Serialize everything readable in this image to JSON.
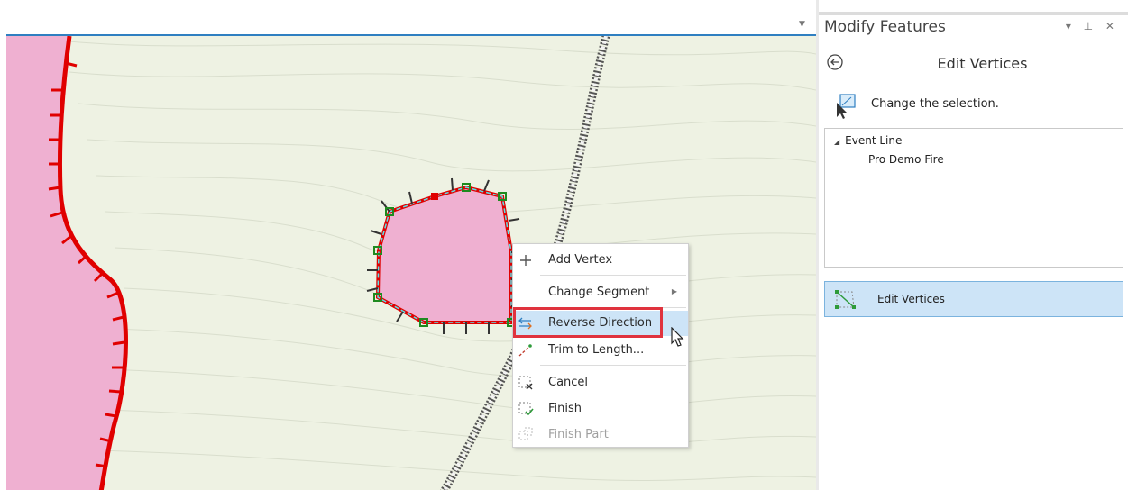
{
  "pane": {
    "title": "Modify Features",
    "controls": "▾ ⊥ ✕",
    "tool_title": "Edit Vertices",
    "selection_prompt": "Change the selection.",
    "tree": {
      "layer": "Event Line",
      "feature": "Pro Demo Fire"
    },
    "tool_button_label": "Edit Vertices"
  },
  "context_menu": {
    "items": [
      {
        "label": "Add Vertex",
        "icon": "plus-icon"
      },
      {
        "label": "Change Segment",
        "icon": "none",
        "submenu": true
      },
      {
        "label": "Reverse Direction",
        "icon": "reverse-direction-icon",
        "highlighted": true
      },
      {
        "label": "Trim to Length...",
        "icon": "trim-icon"
      },
      {
        "label": "Cancel",
        "icon": "cancel-icon"
      },
      {
        "label": "Finish",
        "icon": "finish-icon"
      },
      {
        "label": "Finish Part",
        "icon": "finish-part-icon",
        "disabled": true
      }
    ]
  },
  "colors": {
    "accent": "#2f7fc1",
    "selection_highlight": "#cde4f7",
    "callout_red": "#e0333e",
    "fire_fill": "#efb0d1",
    "fire_line": "#e00000",
    "map_background": "#eef2e3"
  }
}
